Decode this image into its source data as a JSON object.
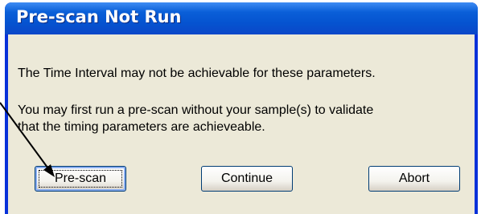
{
  "dialog": {
    "title": "Pre-scan Not Run",
    "message_line1": "The Time Interval may not be achievable for these parameters.",
    "message_line2": "You may first run a pre-scan without your sample(s) to validate",
    "message_line3": "that the timing parameters are achieveable.",
    "buttons": {
      "prescan": "Pre-scan",
      "continue": "Continue",
      "abort": "Abort"
    }
  },
  "colors": {
    "titlebar": "#0553d0",
    "frame": "#0831d9",
    "client_bg": "#ece9d8",
    "title_text": "#ffffff",
    "arrow": "#000000"
  },
  "annotation": {
    "icon": "arrow-pointer-icon"
  }
}
